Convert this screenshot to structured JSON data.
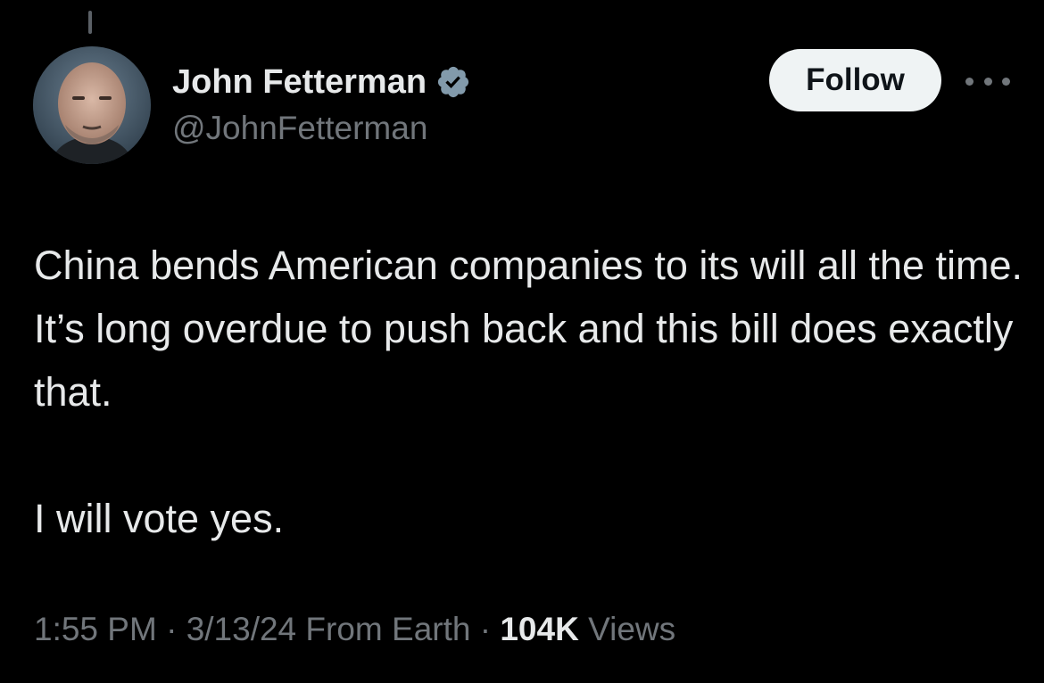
{
  "author": {
    "display_name": "John Fetterman",
    "handle": "@JohnFetterman",
    "verified": true,
    "verified_color": "#829aab"
  },
  "actions": {
    "follow_label": "Follow",
    "more_icon": "more-horizontal-icon"
  },
  "tweet": {
    "paragraphs": [
      "China bends American companies to its will all the time. It’s long overdue to push back and this bill does exactly that.",
      "I will vote yes."
    ]
  },
  "meta": {
    "time": "1:55 PM",
    "date": "3/13/24",
    "location": "From Earth",
    "separator": "·",
    "views_count": "104K",
    "views_label": "Views"
  },
  "colors": {
    "background": "#000000",
    "primary_text": "#e7e9ea",
    "secondary_text": "#71767b",
    "button_bg": "#eff3f4"
  }
}
